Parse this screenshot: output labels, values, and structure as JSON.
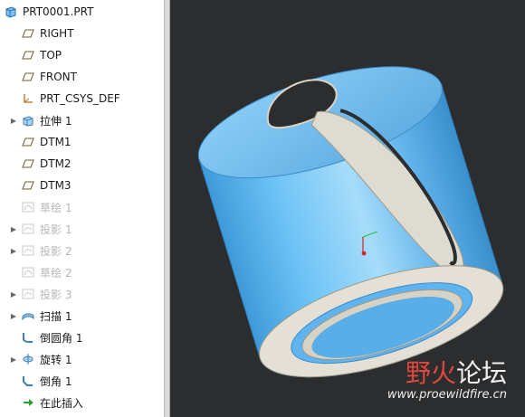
{
  "model_tree": {
    "root_label": "PRT0001.PRT",
    "items": [
      {
        "label": "RIGHT",
        "icon": "datum-plane-icon",
        "expandable": false,
        "suppressed": false
      },
      {
        "label": "TOP",
        "icon": "datum-plane-icon",
        "expandable": false,
        "suppressed": false
      },
      {
        "label": "FRONT",
        "icon": "datum-plane-icon",
        "expandable": false,
        "suppressed": false
      },
      {
        "label": "PRT_CSYS_DEF",
        "icon": "csys-icon",
        "expandable": false,
        "suppressed": false
      },
      {
        "label": "拉伸 1",
        "icon": "extrude-icon",
        "expandable": true,
        "suppressed": false
      },
      {
        "label": "DTM1",
        "icon": "datum-plane-icon",
        "expandable": false,
        "suppressed": false
      },
      {
        "label": "DTM2",
        "icon": "datum-plane-icon",
        "expandable": false,
        "suppressed": false
      },
      {
        "label": "DTM3",
        "icon": "datum-plane-icon",
        "expandable": false,
        "suppressed": false
      },
      {
        "label": "草绘 1",
        "icon": "sketch-icon",
        "expandable": false,
        "suppressed": true
      },
      {
        "label": "投影 1",
        "icon": "projection-icon",
        "expandable": true,
        "suppressed": true
      },
      {
        "label": "投影 2",
        "icon": "projection-icon",
        "expandable": true,
        "suppressed": true
      },
      {
        "label": "草绘 2",
        "icon": "sketch-icon",
        "expandable": false,
        "suppressed": true
      },
      {
        "label": "投影 3",
        "icon": "projection-icon",
        "expandable": true,
        "suppressed": true
      },
      {
        "label": "扫描 1",
        "icon": "sweep-icon",
        "expandable": true,
        "suppressed": false
      },
      {
        "label": "倒圆角 1",
        "icon": "round-icon",
        "expandable": false,
        "suppressed": false
      },
      {
        "label": "旋转 1",
        "icon": "revolve-icon",
        "expandable": true,
        "suppressed": false
      },
      {
        "label": "倒角 1",
        "icon": "chamfer-icon",
        "expandable": false,
        "suppressed": false
      },
      {
        "label": "在此插入",
        "icon": "insert-here-arrow-icon",
        "expandable": false,
        "suppressed": false
      }
    ]
  },
  "watermark": {
    "cn_part1": "野火",
    "cn_part2": "论坛",
    "url": "www.proewildfire.cn"
  },
  "colors": {
    "viewport_bg": "#2b2d2f",
    "part_blue": "#5fb4f0",
    "watermark_red": "#e0483c",
    "suppressed_text": "#b7b7b7"
  }
}
